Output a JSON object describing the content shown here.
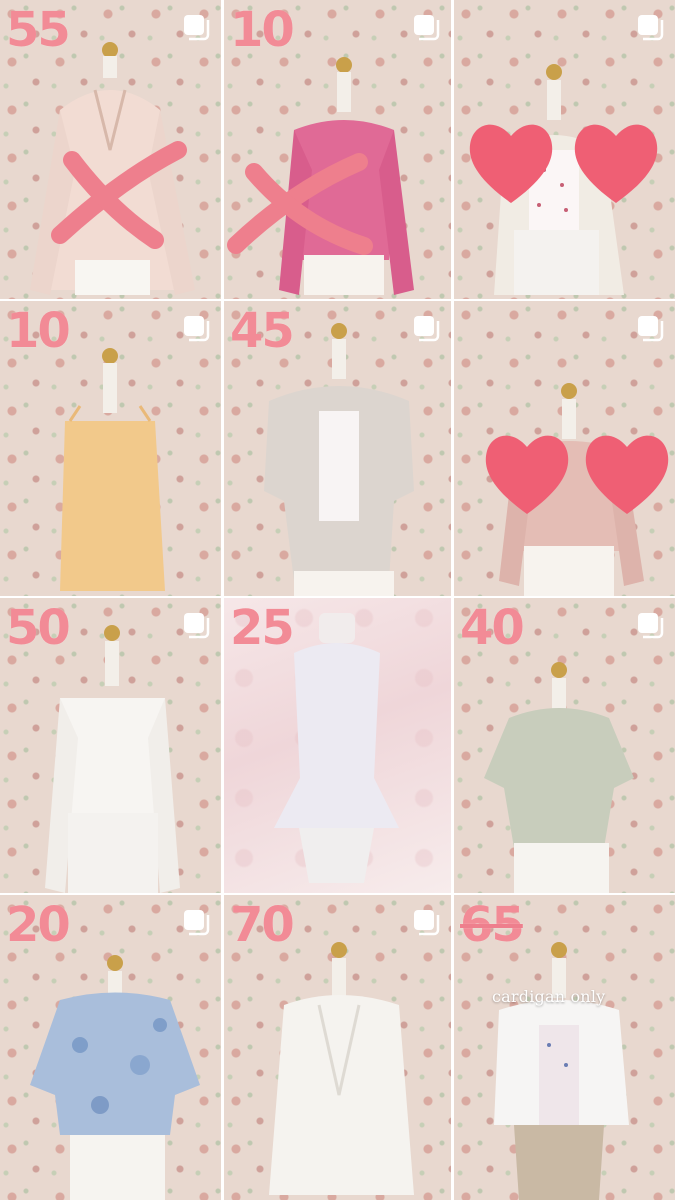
{
  "grid": {
    "posts": [
      {
        "price": "55",
        "sold": true,
        "reserved": false,
        "note": ""
      },
      {
        "price": "10",
        "sold": true,
        "reserved": false,
        "note": ""
      },
      {
        "price": "",
        "sold": false,
        "reserved": true,
        "note": ""
      },
      {
        "price": "10",
        "sold": false,
        "reserved": false,
        "note": ""
      },
      {
        "price": "45",
        "sold": false,
        "reserved": false,
        "note": ""
      },
      {
        "price": "",
        "sold": false,
        "reserved": true,
        "note": ""
      },
      {
        "price": "50",
        "sold": false,
        "reserved": false,
        "note": ""
      },
      {
        "price": "25",
        "sold": false,
        "reserved": false,
        "note": ""
      },
      {
        "price": "40",
        "sold": false,
        "reserved": false,
        "note": ""
      },
      {
        "price": "20",
        "sold": false,
        "reserved": false,
        "note": ""
      },
      {
        "price": "70",
        "sold": false,
        "reserved": false,
        "note": ""
      },
      {
        "price": "65",
        "sold": false,
        "reserved": false,
        "note": "cardigan only",
        "price_struck": true
      }
    ]
  },
  "icons": {
    "multi_post": "multiple-photos-icon",
    "sold_mark": "x-mark-icon",
    "reserved_mark": "heart-icon"
  },
  "colors": {
    "price": "#f28b96",
    "mark": "#ee7f8d",
    "heart": "#ef5f74"
  }
}
